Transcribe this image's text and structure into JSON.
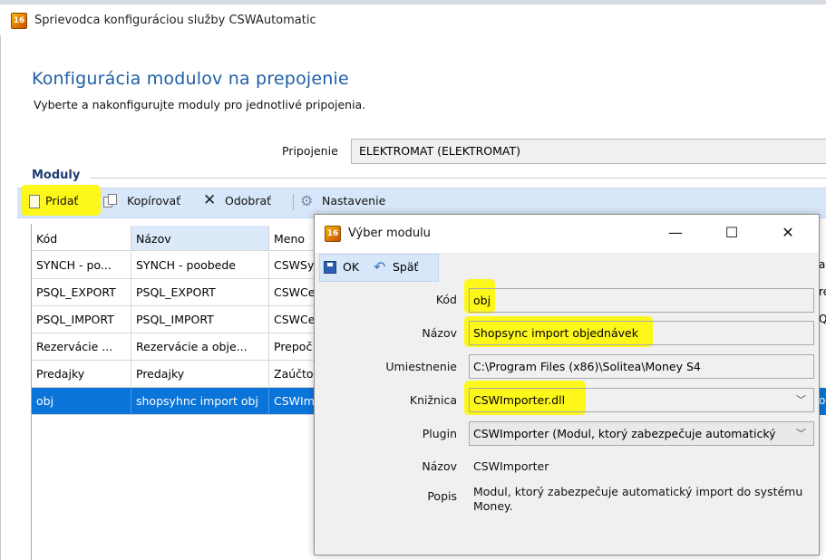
{
  "main_window": {
    "title": "Sprievodca konfiguráciou služby CSWAutomatic",
    "icon_text": "16",
    "page_title": "Konfigurácia modulov na prepojenie",
    "page_subtitle": "Vyberte a nakonfigurujte moduly pro jednotlivé pripojenia.",
    "pripojenie_label": "Pripojenie",
    "pripojenie_value": "ELEKTROMAT (ELEKTROMAT)",
    "group_title": "Moduly"
  },
  "toolbar": {
    "add": "Pridať",
    "copy": "Kopírovať",
    "remove": "Odobrať",
    "settings": "Nastavenie"
  },
  "grid": {
    "columns": [
      "Kód",
      "Názov",
      "Meno"
    ],
    "rows": [
      {
        "kod": "SYNCH - po...",
        "nazov": "SYNCH - poobede",
        "meno": "CSWSy"
      },
      {
        "kod": "PSQL_EXPORT",
        "nazov": "PSQL_EXPORT",
        "meno": "CSWCe"
      },
      {
        "kod": "PSQL_IMPORT",
        "nazov": "PSQL_IMPORT",
        "meno": "CSWCe"
      },
      {
        "kod": "Rezervácie ...",
        "nazov": "Rezervácie a obje...",
        "meno": "Prepoč"
      },
      {
        "kod": "Predajky",
        "nazov": "Predajky",
        "meno": "Zaúčto"
      },
      {
        "kod": "obj",
        "nazov": "shopsyhnc import obj",
        "meno": "CSWIm",
        "selected": true
      }
    ]
  },
  "right_edge_fragments": [
    "a",
    "re",
    "Q",
    "",
    "",
    "o"
  ],
  "dialog": {
    "title": "Výber modulu",
    "icon_text": "16",
    "minimize": "—",
    "maximize": "☐",
    "close": "✕",
    "ok_label": "OK",
    "back_label": "Späť",
    "fields": {
      "kod_label": "Kód",
      "kod_value": "obj",
      "nazov_label": "Názov",
      "nazov_value": "Shopsync import objednávek",
      "umiestnenie_label": "Umiestnenie",
      "umiestnenie_value": "C:\\Program Files (x86)\\Solitea\\Money S4",
      "kniznica_label": "Knižnica",
      "kniznica_value": "CSWImporter.dll",
      "plugin_label": "Plugin",
      "plugin_value": "CSWImporter (Modul, ktorý zabezpečuje automatický",
      "plugin_nazov_label": "Názov",
      "plugin_nazov_value": "CSWImporter",
      "popis_label": "Popis",
      "popis_value": "Modul, ktorý zabezpečuje automatický import do systému Money."
    }
  },
  "colors": {
    "accent_title": "#1f5fa6",
    "selection": "#0a74d8",
    "toolbar_bg": "#d7e6f8",
    "highlight": "#fdf71a"
  }
}
